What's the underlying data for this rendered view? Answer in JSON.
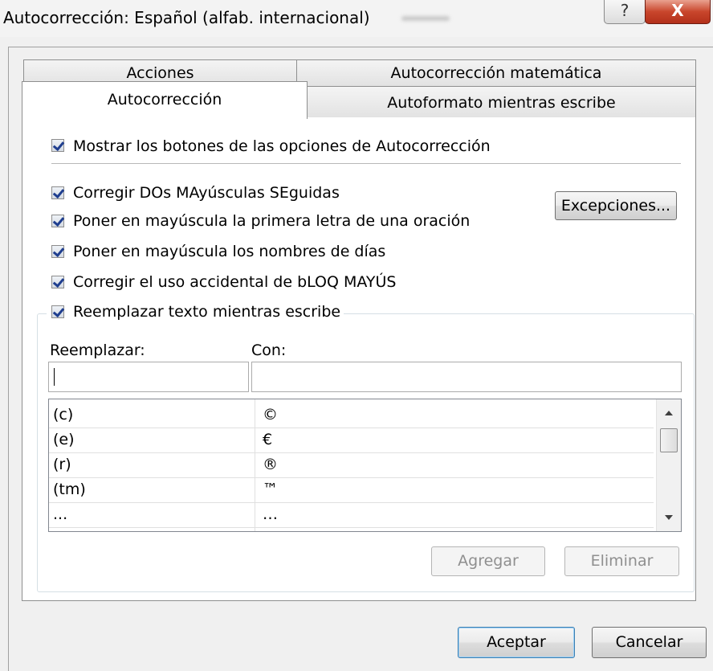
{
  "window": {
    "title": "Autocorrección: Español (alfab. internacional)",
    "help_glyph": "?",
    "close_glyph": "X"
  },
  "tabs": {
    "row1": [
      {
        "label": "Acciones",
        "active": false
      },
      {
        "label": "Autocorrección matemática",
        "active": false
      }
    ],
    "row2": [
      {
        "label": "Autocorrección",
        "active": true
      },
      {
        "label": "Autoformato mientras escribe",
        "active": false
      }
    ]
  },
  "options": {
    "show_buttons": {
      "label": "Mostrar los botones de las opciones de Autocorrección",
      "checked": true
    },
    "two_caps": {
      "label": "Corregir DOs MAyúsculas SEguidas",
      "checked": true
    },
    "sentence_cap": {
      "label": "Poner en mayúscula la primera letra de una oración",
      "checked": true
    },
    "day_names": {
      "label": "Poner en mayúscula los nombres de días",
      "checked": true
    },
    "caps_lock": {
      "label": "Corregir el uso accidental de bLOQ MAYÚS",
      "checked": true
    },
    "replace_text": {
      "label": "Reemplazar texto mientras escribe",
      "checked": true
    }
  },
  "buttons": {
    "exceptions": "Excepciones...",
    "add": "Agregar",
    "delete": "Eliminar",
    "ok": "Aceptar",
    "cancel": "Cancelar"
  },
  "replace": {
    "replace_label": "Reemplazar:",
    "with_label": "Con:",
    "replace_value": "",
    "with_value": "",
    "entries": [
      {
        "from": "(c)",
        "to": "©"
      },
      {
        "from": "(e)",
        "to": "€"
      },
      {
        "from": "(r)",
        "to": "®"
      },
      {
        "from": "(tm)",
        "to": "™"
      },
      {
        "from": "...",
        "to": "…"
      }
    ]
  },
  "colors": {
    "accent_check": "#1f3e8f",
    "close_button": "#c9462c",
    "default_button_border": "#3c7fb1"
  }
}
